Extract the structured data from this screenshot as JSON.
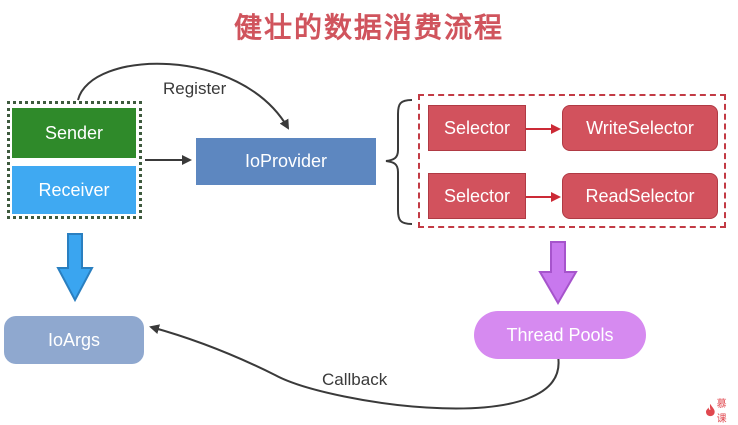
{
  "title": "健壮的数据消费流程",
  "nodes": {
    "sender": "Sender",
    "receiver": "Receiver",
    "ioprovider": "IoProvider",
    "selector_1": "Selector",
    "selector_2": "Selector",
    "write_selector": "WriteSelector",
    "read_selector": "ReadSelector",
    "ioargs": "IoArgs",
    "thread_pools": "Thread Pools"
  },
  "edges": {
    "register": "Register",
    "callback": "Callback"
  },
  "colors": {
    "title": "#d0545d",
    "sender": "#2f8a2a",
    "receiver": "#3fa9f2",
    "ioprovider": "#5d87c0",
    "selector": "#d2525d",
    "ioargs": "#8fa8cf",
    "thread_pools": "#d68af0",
    "text_dark": "#3a3a3a"
  },
  "logo": {
    "icon": "flame-logo-icon",
    "text": "慕课"
  }
}
